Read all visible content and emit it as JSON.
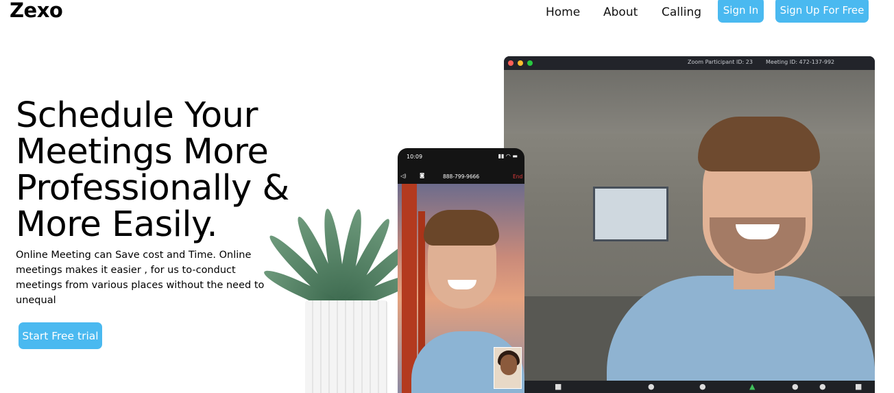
{
  "nav": {
    "brand": "Zexo",
    "links": [
      "Home",
      "About",
      "Calling"
    ],
    "sign_in": "Sign In",
    "sign_up": "Sign Up For Free"
  },
  "hero": {
    "title": "Schedule Your Meetings More Professionally & More Easily.",
    "description": "Online Meeting can Save cost and Time. Online meetings makes it easier , for us to-conduct meetings from various places without the need to unequal",
    "cta": "Start Free trial"
  },
  "desktop_window": {
    "participant_id": "Zoom Participant ID: 23",
    "meeting_id": "Meeting ID: 472-137-992"
  },
  "phone": {
    "time": "10:09",
    "phone_number": "888-799-9666",
    "end_label": "End"
  },
  "colors": {
    "accent": "#4ab9f0",
    "text": "#000000",
    "background": "#ffffff"
  }
}
